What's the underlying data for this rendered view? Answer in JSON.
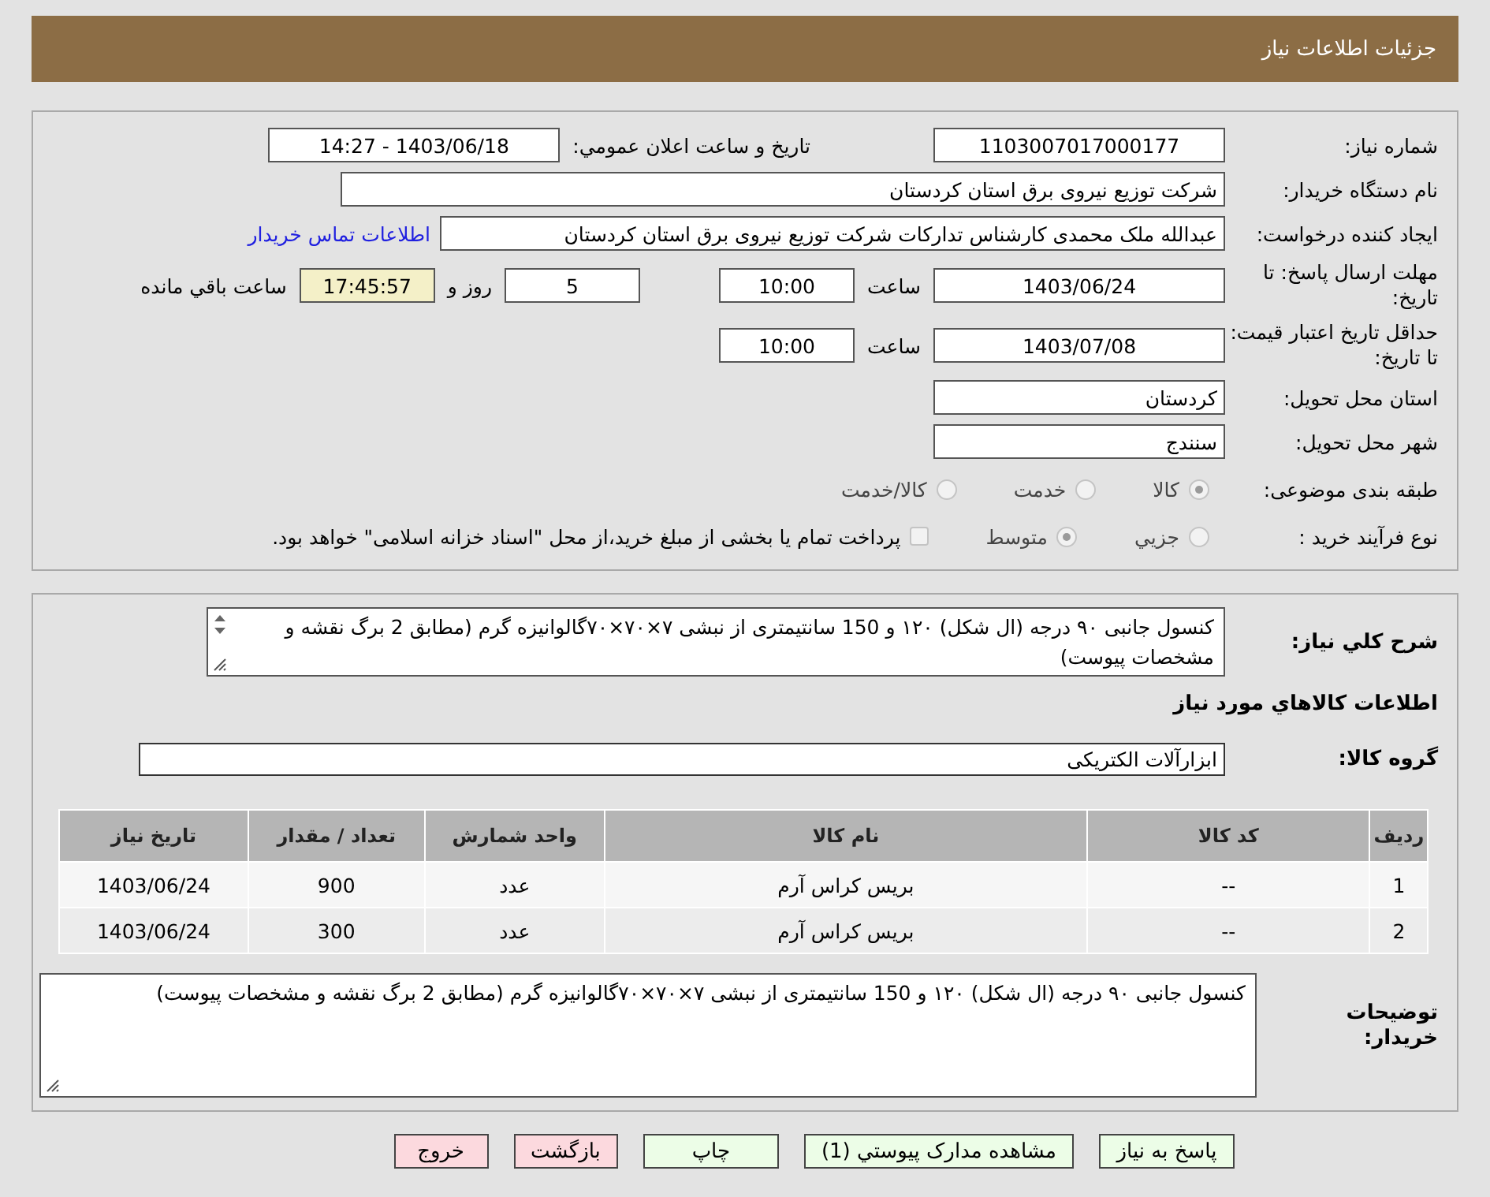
{
  "title": "جزئیات اطلاعات نیاز",
  "need_number": {
    "label": "شماره نیاز:",
    "value": "1103007017000177"
  },
  "announce": {
    "label": "تاریخ و ساعت اعلان عمومي:",
    "value": "1403/06/18 - 14:27"
  },
  "buyer": {
    "label": "نام دستگاه خریدار:",
    "value": "شرکت توزیع نیروی برق استان کردستان"
  },
  "requester": {
    "label": "ایجاد کننده درخواست:",
    "value": "عبدالله ملک محمدی کارشناس تدارکات شرکت توزیع نیروی برق استان کردستان",
    "link": "اطلاعات تماس خریدار"
  },
  "deadline": {
    "label": "مهلت ارسال پاسخ: تا تاریخ:",
    "date": "1403/06/24",
    "time_label": "ساعت",
    "time": "10:00",
    "days": "5",
    "days_label": "روز و",
    "remaining": "17:45:57",
    "remaining_label": "ساعت باقي مانده"
  },
  "validity": {
    "label": "حداقل تاریخ اعتبار قیمت: تا تاریخ:",
    "date": "1403/07/08",
    "time_label": "ساعت",
    "time": "10:00"
  },
  "province": {
    "label": "استان محل تحویل:",
    "value": "کردستان"
  },
  "city": {
    "label": "شهر محل تحویل:",
    "value": "سنندج"
  },
  "category": {
    "label": "طبقه بندی موضوعی:",
    "options": [
      {
        "label": "کالا",
        "selected": true
      },
      {
        "label": "خدمت",
        "selected": false
      },
      {
        "label": "کالا/خدمت",
        "selected": false
      }
    ]
  },
  "purchase_type": {
    "label": "نوع فرآیند خرید :",
    "options": [
      {
        "label": "جزيي",
        "selected": false
      },
      {
        "label": "متوسط",
        "selected": true
      }
    ],
    "payment": {
      "label": "پرداخت تمام یا بخشی از مبلغ خرید،از محل \"اسناد خزانه اسلامی\" خواهد بود.",
      "checked": false
    }
  },
  "description": {
    "label": "شرح کلي نياز:",
    "value": "کنسول جانبی ۹۰ درجه (ال شکل) ۱۲۰ و 150 سانتیمتری از نبشی ۷×۷۰×۷۰گالوانیزه گرم (مطابق 2 برگ نقشه و مشخصات پیوست)"
  },
  "goods_heading": "اطلاعات کالاهاي مورد نياز",
  "goods_group": {
    "label": "گروه کالا:",
    "value": "ابزارآلات الکتریکی"
  },
  "table": {
    "columns": [
      "ردیف",
      "کد کالا",
      "نام کالا",
      "واحد شمارش",
      "تعداد / مقدار",
      "تاریخ نیاز"
    ],
    "rows": [
      [
        "1",
        "--",
        "بریس کراس آرم",
        "عدد",
        "900",
        "1403/06/24"
      ],
      [
        "2",
        "--",
        "بریس کراس آرم",
        "عدد",
        "300",
        "1403/06/24"
      ]
    ]
  },
  "notes": {
    "label": "توضیحات خریدار:",
    "value": "کنسول جانبی ۹۰ درجه (ال شکل) ۱۲۰ و 150 سانتیمتری از نبشی ۷×۷۰×۷۰گالوانیزه گرم (مطابق 2 برگ نقشه و مشخصات پیوست)"
  },
  "buttons": [
    {
      "label": "پاسخ به نياز",
      "kind": "action"
    },
    {
      "label": "مشاهده مدارک پیوستي (1)",
      "kind": "action"
    },
    {
      "label": "چاپ",
      "kind": "action"
    },
    {
      "label": "بازگشت",
      "kind": "exit"
    },
    {
      "label": "خروج",
      "kind": "exit"
    }
  ]
}
